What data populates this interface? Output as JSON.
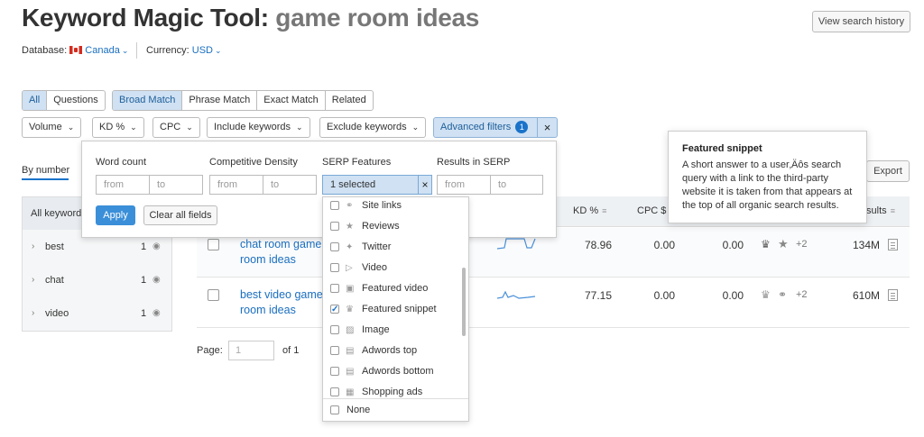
{
  "header": {
    "title": "Keyword Magic Tool:",
    "query": "game room ideas",
    "history_button": "View search history"
  },
  "meta": {
    "database_label": "Database:",
    "database_value": "Canada",
    "currency_label": "Currency:",
    "currency_value": "USD"
  },
  "match_tabs": [
    {
      "label": "All",
      "active": true
    },
    {
      "label": "Questions",
      "active": false
    }
  ],
  "match_types": [
    {
      "label": "Broad Match",
      "active": true
    },
    {
      "label": "Phrase Match",
      "active": false
    },
    {
      "label": "Exact Match",
      "active": false
    },
    {
      "label": "Related",
      "active": false
    }
  ],
  "filters": {
    "volume": "Volume",
    "kd": "KD %",
    "cpc": "CPC",
    "include": "Include keywords",
    "exclude": "Exclude keywords",
    "advanced": "Advanced filters",
    "advanced_count": "1"
  },
  "adv_panel": {
    "word_count": "Word count",
    "comp_density": "Competitive Density",
    "serp_features": "SERP Features",
    "results": "Results in SERP",
    "from": "from",
    "to": "to",
    "selected": "1 selected",
    "apply": "Apply",
    "clear": "Clear all fields"
  },
  "serp_options": [
    {
      "label": "Site links",
      "icon": "link-icon",
      "checked": false
    },
    {
      "label": "Reviews",
      "icon": "star-icon",
      "checked": false
    },
    {
      "label": "Twitter",
      "icon": "twitter-icon",
      "checked": false
    },
    {
      "label": "Video",
      "icon": "video-icon",
      "checked": false
    },
    {
      "label": "Featured video",
      "icon": "featured-video-icon",
      "checked": false
    },
    {
      "label": "Featured snippet",
      "icon": "crown-icon",
      "checked": true
    },
    {
      "label": "Image",
      "icon": "image-icon",
      "checked": false
    },
    {
      "label": "Adwords top",
      "icon": "ad-icon",
      "checked": false
    },
    {
      "label": "Adwords bottom",
      "icon": "ad-icon",
      "checked": false
    },
    {
      "label": "Shopping ads",
      "icon": "cart-icon",
      "checked": false
    }
  ],
  "serp_none": "None",
  "group_tabs": {
    "by_number": "By number"
  },
  "sidebar": {
    "header": "All keywords",
    "items": [
      {
        "label": "best",
        "count": "1"
      },
      {
        "label": "chat",
        "count": "1"
      },
      {
        "label": "video",
        "count": "1"
      }
    ]
  },
  "table": {
    "columns": {
      "kd": "KD %",
      "cpc": "CPC $",
      "results": "Results"
    },
    "rows": [
      {
        "keyword": "chat room game room ideas",
        "kd": "78.96",
        "cpc": "0.00",
        "density": "0.00",
        "more": "+2",
        "results": "134M"
      },
      {
        "keyword": "best video game room ideas",
        "kd": "77.15",
        "cpc": "0.00",
        "density": "0.00",
        "more": "+2",
        "results": "610M"
      }
    ]
  },
  "export": "Export",
  "tooltip": {
    "title": "Featured snippet",
    "body": "A short answer to a user‚Äôs search query with a link to the third-party website it is taken from that appears at the top of all organic search results."
  },
  "pagination": {
    "label": "Page:",
    "value": "1",
    "of": "of 1"
  },
  "colors": {
    "accent": "#1a73c9",
    "active_bg": "#cfe1f3",
    "link": "#1a6fc0"
  }
}
